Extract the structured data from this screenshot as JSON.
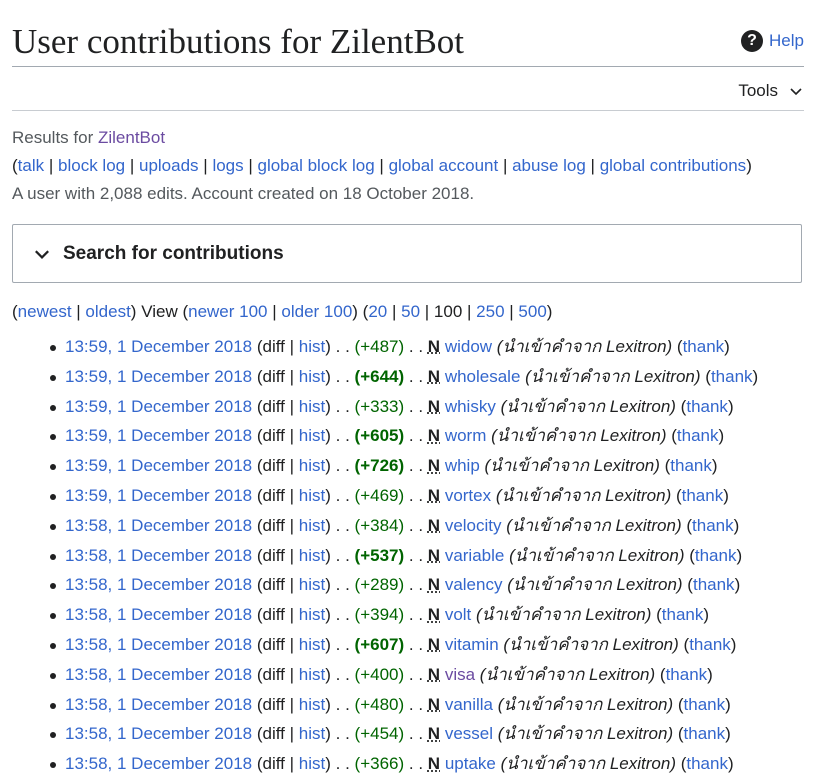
{
  "page": {
    "title": "User contributions for ZilentBot",
    "help_label": "Help",
    "tools_label": "Tools"
  },
  "results": {
    "prefix": "Results for ",
    "user": "ZilentBot",
    "links": [
      "talk",
      "block log",
      "uploads",
      "logs",
      "global block log",
      "global account",
      "abuse log",
      "global contributions"
    ],
    "summary_line": "A user with 2,088 edits. Account created on 18 October 2018."
  },
  "search": {
    "label": "Search for contributions"
  },
  "nav": {
    "newest": "newest",
    "oldest": "oldest",
    "view": "View",
    "newer": "newer 100",
    "older": "older 100",
    "limits": [
      "20",
      "50",
      "100",
      "250",
      "500"
    ],
    "current_limit": "100"
  },
  "labels": {
    "diff": "diff",
    "hist": "hist",
    "dots": ". .",
    "new_marker": "N",
    "thank": "thank"
  },
  "contributions": [
    {
      "time": "13:59, 1 December 2018",
      "size": "(+487)",
      "big": false,
      "page": "widow",
      "comment": "(นำเข้าคำจาก Lexitron)"
    },
    {
      "time": "13:59, 1 December 2018",
      "size": "(+644)",
      "big": true,
      "page": "wholesale",
      "comment": "(นำเข้าคำจาก Lexitron)"
    },
    {
      "time": "13:59, 1 December 2018",
      "size": "(+333)",
      "big": false,
      "page": "whisky",
      "comment": "(นำเข้าคำจาก Lexitron)"
    },
    {
      "time": "13:59, 1 December 2018",
      "size": "(+605)",
      "big": true,
      "page": "worm",
      "comment": "(นำเข้าคำจาก Lexitron)"
    },
    {
      "time": "13:59, 1 December 2018",
      "size": "(+726)",
      "big": true,
      "page": "whip",
      "comment": "(นำเข้าคำจาก Lexitron)"
    },
    {
      "time": "13:59, 1 December 2018",
      "size": "(+469)",
      "big": false,
      "page": "vortex",
      "comment": "(นำเข้าคำจาก Lexitron)"
    },
    {
      "time": "13:58, 1 December 2018",
      "size": "(+384)",
      "big": false,
      "page": "velocity",
      "comment": "(นำเข้าคำจาก Lexitron)"
    },
    {
      "time": "13:58, 1 December 2018",
      "size": "(+537)",
      "big": true,
      "page": "variable",
      "comment": "(นำเข้าคำจาก Lexitron)"
    },
    {
      "time": "13:58, 1 December 2018",
      "size": "(+289)",
      "big": false,
      "page": "valency",
      "comment": "(นำเข้าคำจาก Lexitron)"
    },
    {
      "time": "13:58, 1 December 2018",
      "size": "(+394)",
      "big": false,
      "page": "volt",
      "comment": "(นำเข้าคำจาก Lexitron)"
    },
    {
      "time": "13:58, 1 December 2018",
      "size": "(+607)",
      "big": true,
      "page": "vitamin",
      "comment": "(นำเข้าคำจาก Lexitron)"
    },
    {
      "time": "13:58, 1 December 2018",
      "size": "(+400)",
      "big": false,
      "page": "visa",
      "visited": true,
      "comment": "(นำเข้าคำจาก Lexitron)"
    },
    {
      "time": "13:58, 1 December 2018",
      "size": "(+480)",
      "big": false,
      "page": "vanilla",
      "comment": "(นำเข้าคำจาก Lexitron)"
    },
    {
      "time": "13:58, 1 December 2018",
      "size": "(+454)",
      "big": false,
      "page": "vessel",
      "comment": "(นำเข้าคำจาก Lexitron)"
    },
    {
      "time": "13:58, 1 December 2018",
      "size": "(+366)",
      "big": false,
      "page": "uptake",
      "comment": "(นำเข้าคำจาก Lexitron)"
    }
  ]
}
